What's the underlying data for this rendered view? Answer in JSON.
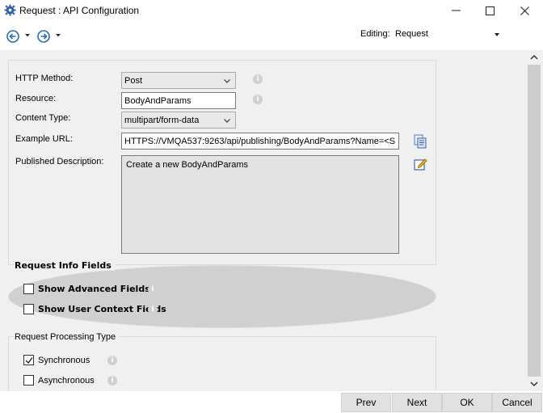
{
  "window": {
    "title": "Request : API Configuration",
    "min_glyph": "—",
    "max_glyph": "☐",
    "close_glyph": "✕"
  },
  "toolbar": {
    "editing_label": "Editing:",
    "editing_value": "Request"
  },
  "form": {
    "http_method_label": "HTTP Method:",
    "http_method_value": "Post",
    "resource_label": "Resource:",
    "resource_value": "BodyAndParams",
    "content_type_label": "Content Type:",
    "content_type_value": "multipart/form-data",
    "example_url_label": "Example URL:",
    "example_url_value": "HTTPS://VMQA537:9263/api/publishing/BodyAndParams?Name=<S",
    "published_description_label": "Published Description:",
    "published_description_value": "Create a new BodyAndParams"
  },
  "request_info_fields": {
    "title": "Request Info Fields",
    "show_advanced_fields": {
      "label": "Show Advanced Fields",
      "checked": false
    },
    "show_user_context_fields": {
      "label": "Show User Context Fields",
      "checked": false
    }
  },
  "request_processing_type": {
    "title": "Request Processing Type",
    "synchronous": {
      "label": "Synchronous",
      "checked": true
    },
    "asynchronous": {
      "label": "Asynchronous",
      "checked": false
    }
  },
  "footer": {
    "prev_label": "Prev",
    "next_label": "Next",
    "ok_label": "OK",
    "cancel_label": "Cancel"
  },
  "info_glyph": "i",
  "colors": {
    "app_icon": "#2b5fad",
    "nav_icon": "#2b6cb0",
    "panel_bg": "#f0f0f0",
    "scroll_thumb": "#cdcdcd"
  }
}
